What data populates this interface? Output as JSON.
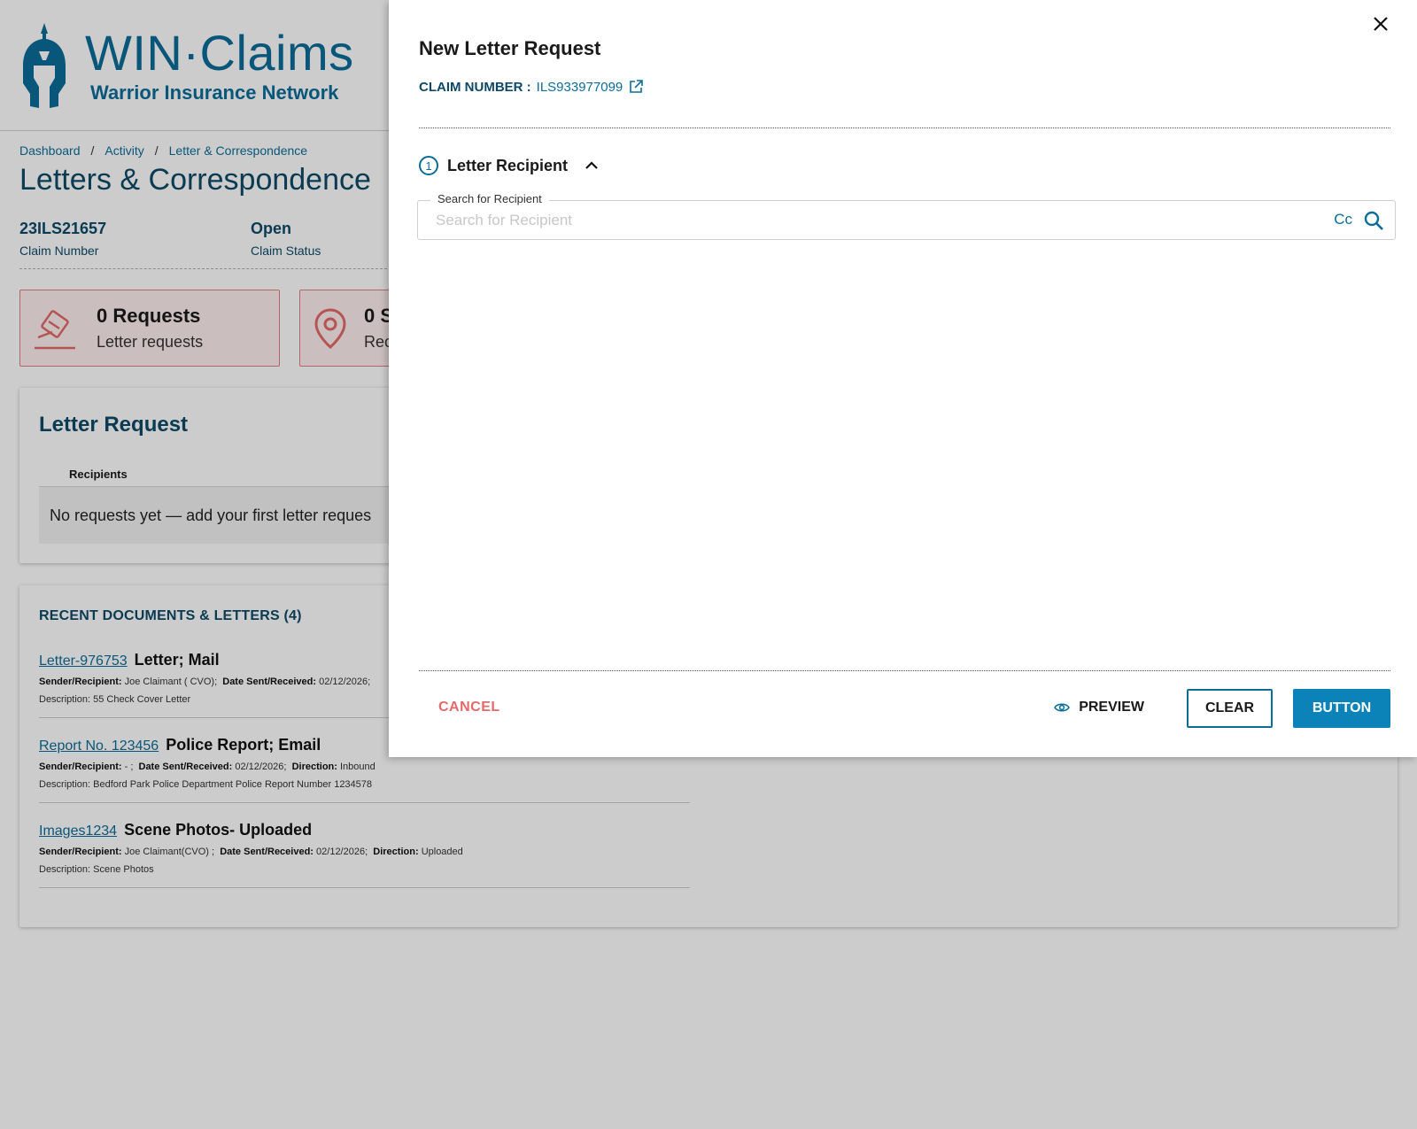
{
  "brand": {
    "name": "WIN·Claims",
    "subtitle": "Warrior Insurance Network"
  },
  "breadcrumb": [
    "Dashboard",
    "Activity",
    "Letter & Correspondence"
  ],
  "page_title": "Letters & Correspondence",
  "claim_meta": [
    {
      "value": "23ILS21657",
      "label": "Claim Number"
    },
    {
      "value": "Open",
      "label": "Claim Status"
    }
  ],
  "stats": [
    {
      "number": "0 Requests",
      "label": "Letter requests"
    },
    {
      "number": "0 S",
      "label": "Rec"
    }
  ],
  "letter_request_panel": {
    "title": "Letter Request",
    "column": "Recipients",
    "empty_text": "No requests yet — add your first letter reques"
  },
  "recent": {
    "title": "RECENT DOCUMENTS & LETTERS (4)",
    "items": [
      {
        "link": "Letter-976753",
        "name": "Letter; Mail",
        "sender_label": "Sender/Recipient:",
        "sender": "Joe Claimant ( CVO);",
        "date_label": "Date Sent/Received:",
        "date": "02/12/2026;",
        "direction_label": "",
        "direction": "",
        "description": "Description: 55 Check Cover Letter"
      },
      {
        "link": "Report No. 123456",
        "name": "Police Report; Email",
        "sender_label": "Sender/Recipient:",
        "sender": "- ;",
        "date_label": "Date Sent/Received:",
        "date": "02/12/2026;",
        "direction_label": "Direction:",
        "direction": "Inbound",
        "description": "Description: Bedford Park Police Department Police Report Number 1234578"
      },
      {
        "link": "Images1234",
        "name": "Scene Photos- Uploaded",
        "sender_label": "Sender/Recipient:",
        "sender": "Joe Claimant(CVO) ;",
        "date_label": "Date Sent/Received:",
        "date": "02/12/2026;",
        "direction_label": "Direction:",
        "direction": "Uploaded",
        "description": "Description: Scene Photos"
      }
    ]
  },
  "drawer": {
    "title": "New Letter Request",
    "claim_label": "CLAIM NUMBER :",
    "claim_value": "ILS933977099",
    "step_number": "1",
    "step_label": "Letter Recipient",
    "search_legend": "Search for Recipient",
    "search_placeholder": "Search for Recipient",
    "search_value": "",
    "cc_label": "Cc",
    "cancel_label": "CANCEL",
    "preview_label": "PREVIEW",
    "clear_label": "CLEAR",
    "primary_label": "BUTTON"
  },
  "colors": {
    "brand": "#0b6d99",
    "primary": "#0b83b8",
    "cancel": "#e46a6a",
    "stat_border": "#e08080"
  }
}
